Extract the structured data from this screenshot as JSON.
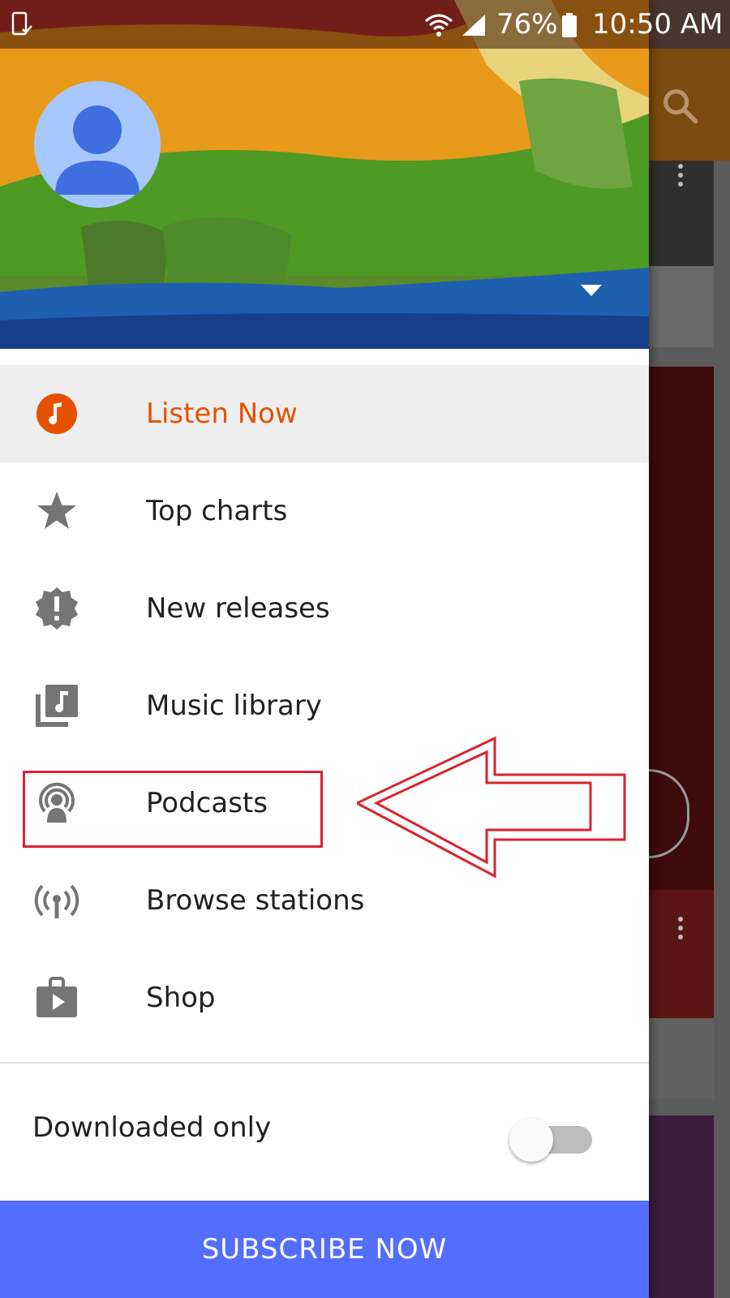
{
  "status_bar": {
    "battery_percent": "76%",
    "time": "10:50 AM",
    "icons": [
      "notification-icon",
      "wifi-icon",
      "signal-icon",
      "battery-icon"
    ]
  },
  "drawer": {
    "header": {
      "avatar_icon": "person-icon",
      "account_menu_icon": "dropdown-triangle-icon"
    },
    "menu_items": [
      {
        "label": "Listen Now",
        "icon": "music-note-circle-icon",
        "active": true
      },
      {
        "label": "Top charts",
        "icon": "star-icon"
      },
      {
        "label": "New releases",
        "icon": "new-badge-icon"
      },
      {
        "label": "Music library",
        "icon": "music-library-icon"
      },
      {
        "label": "Podcasts",
        "icon": "podcast-icon"
      },
      {
        "label": "Browse stations",
        "icon": "radio-tower-icon"
      },
      {
        "label": "Shop",
        "icon": "shopping-bag-play-icon"
      }
    ],
    "downloaded_only": {
      "label": "Downloaded only",
      "enabled": false
    },
    "subscribe_button": "SUBSCRIBE NOW"
  },
  "annotation": {
    "highlighted_item": "Podcasts",
    "color": "#d9232e"
  },
  "colors": {
    "accent_orange": "#e65100",
    "subscribe_blue": "#536dfe",
    "icon_gray": "#757575"
  }
}
